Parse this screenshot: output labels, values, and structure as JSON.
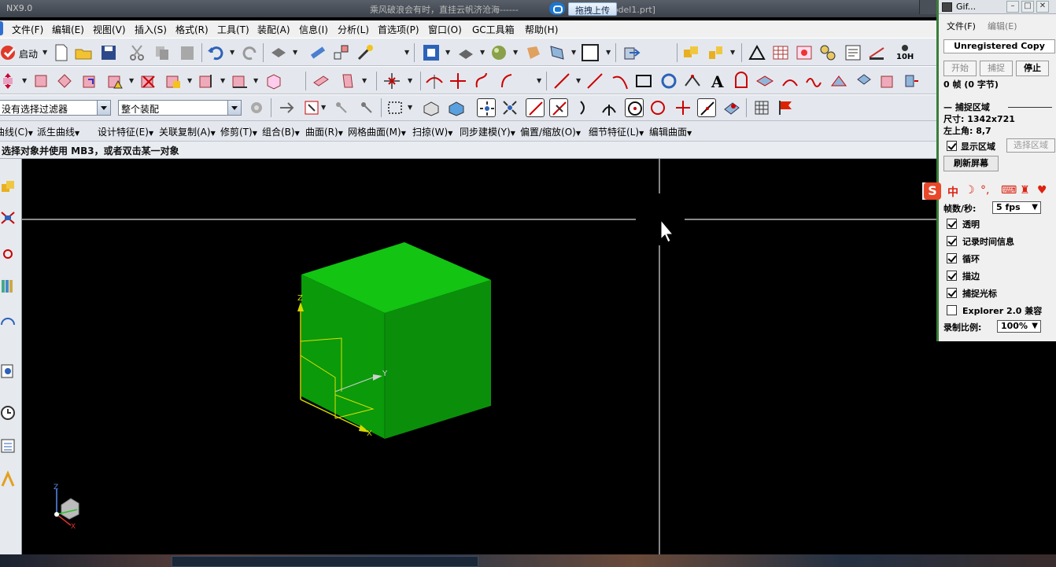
{
  "window": {
    "app_name": "NX9.0",
    "title": "乘风破浪会有时，直挂云帆济沧海------",
    "title_tail": "odel1.prt]",
    "upload_label": "拖拽上传"
  },
  "menu": [
    "文件(F)",
    "编辑(E)",
    "视图(V)",
    "插入(S)",
    "格式(R)",
    "工具(T)",
    "装配(A)",
    "信息(I)",
    "分析(L)",
    "首选项(P)",
    "窗口(O)",
    "GC工具箱",
    "帮助(H)"
  ],
  "toolbar": {
    "start_label": "启动",
    "filter_value": "没有选择过滤器",
    "assembly_scope_value": "整个装配"
  },
  "feature_menu": [
    "曲线(C)",
    "派生曲线",
    "设计特征(E)",
    "关联复制(A)",
    "修剪(T)",
    "组合(B)",
    "曲面(R)",
    "网格曲面(M)",
    "扫掠(W)",
    "同步建模(Y)",
    "偏置/缩放(O)",
    "细节特征(L)",
    "编辑曲面"
  ],
  "status": {
    "cue": "选择对象并使用 MB3，或者双击某一对象"
  },
  "viewport": {
    "axis_labels": {
      "z": "Z",
      "y": "Y",
      "x": "X"
    },
    "model_color": "#00a000",
    "top_color": "#13c413",
    "side_color": "#0b8f0b",
    "background": "#000000"
  },
  "gifcam": {
    "title": "Gif...",
    "menu_file": "文件(F)",
    "menu_edit": "编辑(E)",
    "unregistered": "Unregistered Copy",
    "btn_start": "开始",
    "btn_capture": "捕捉",
    "btn_stop": "停止",
    "frames": "0 帧 (0 字节)",
    "capture_area_header": "捕捉区域",
    "size": "尺寸: 1342x721",
    "topleft": "左上角: 8,7",
    "show_area": "显示区域",
    "select_area": "选择区域",
    "refresh": "刷新屏幕",
    "fps_label": "帧数/秒:",
    "fps_value": "5 fps",
    "opt_transparent": "透明",
    "opt_timestamp": "记录时间信息",
    "opt_loop": "循环",
    "opt_border": "描边",
    "opt_cursor": "捕捉光标",
    "opt_explorer": "Explorer 2.0 兼容",
    "ratio_label": "录制比例:",
    "ratio_value": "100%"
  },
  "ime": {
    "logo": "S",
    "mode": "中"
  }
}
